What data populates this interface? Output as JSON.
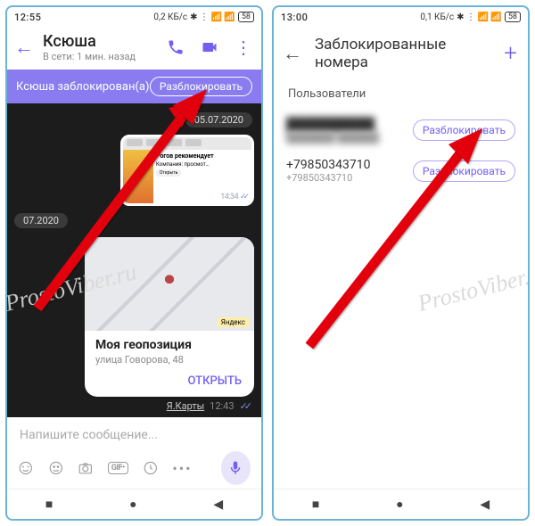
{
  "watermark": "ProstoViber.ru",
  "left": {
    "status": {
      "time": "12:55",
      "net": "0,2 КБ/с",
      "battery": "58"
    },
    "header": {
      "name": "Ксюша",
      "status": "В сети: 1 мин. назад"
    },
    "banner": {
      "blocked_text": "Ксюша заблокирован(а)",
      "unblock": "Разблокировать"
    },
    "chat": {
      "date1": "05.07.2020",
      "thumb": {
        "title": "Рогов рекомендует",
        "sub": "Компания: просмот…",
        "btn": "Открыть"
      },
      "thumb_time": "14:34",
      "date2": "07.2020",
      "map_badge": "Яндекс",
      "loc_title": "Моя геопозиция",
      "loc_addr": "улица Говорова, 48",
      "loc_open": "ОТКРЫТЬ",
      "bot_name": "Я.Карты",
      "bot_time": "12:43"
    },
    "input": {
      "placeholder": "Напишите сообщение...",
      "gif_label": "GIF•"
    }
  },
  "right": {
    "status": {
      "time": "13:00",
      "net": "0,1 КБ/с",
      "battery": "58"
    },
    "header": {
      "title": "Заблокированные номера"
    },
    "section": "Пользователи",
    "users": [
      {
        "name": "██████████",
        "sub": "███████ ██████",
        "unblock": "Разблокировать"
      },
      {
        "name": "+79850343710",
        "sub": "+79850343710",
        "unblock": "Разблокировать"
      }
    ]
  }
}
